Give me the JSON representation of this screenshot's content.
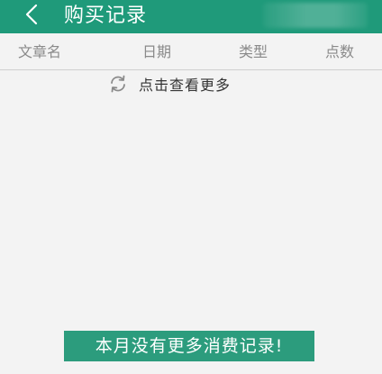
{
  "header": {
    "title": "购买记录",
    "back_icon": "chevron-left-icon"
  },
  "columns": [
    "文章名",
    "日期",
    "类型",
    "点数"
  ],
  "load_more": {
    "icon": "refresh-icon",
    "label": "点击查看更多"
  },
  "toast": {
    "message": "本月没有更多消费记录!"
  },
  "colors": {
    "header_bg": "#1f9a7a",
    "toast_bg": "#2c9c7d",
    "page_bg": "#f3f3f3"
  }
}
